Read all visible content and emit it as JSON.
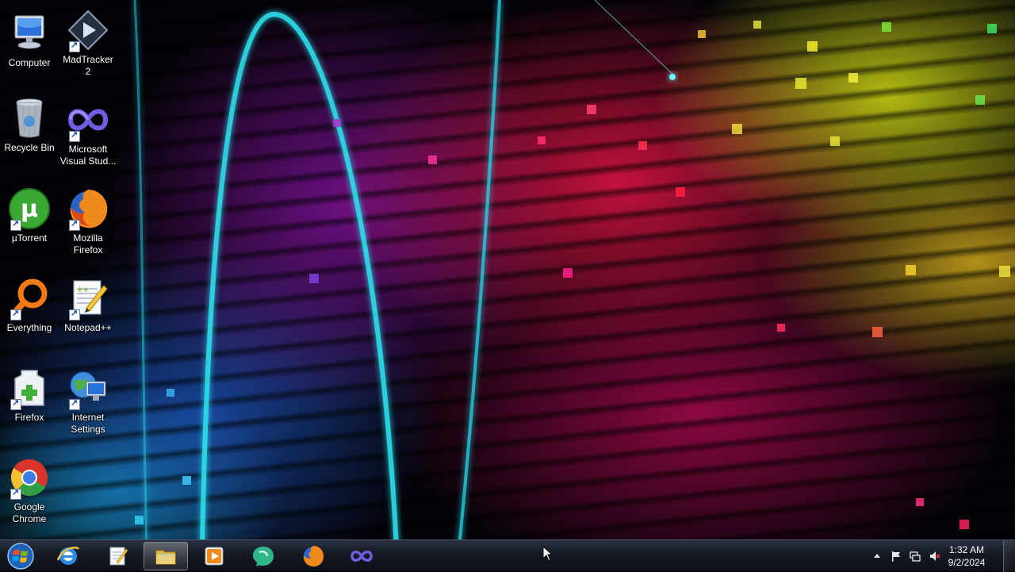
{
  "desktop": {
    "icons": [
      {
        "label": "Computer",
        "icon": "computer-icon"
      },
      {
        "label": "MadTracker 2",
        "icon": "madtracker-icon"
      },
      {
        "label": "Recycle Bin",
        "icon": "recycle-bin-icon"
      },
      {
        "label": "Microsoft Visual Stud...",
        "icon": "visual-studio-icon"
      },
      {
        "label": "µTorrent",
        "icon": "utorrent-icon"
      },
      {
        "label": "Mozilla Firefox",
        "icon": "firefox-icon"
      },
      {
        "label": "Everything",
        "icon": "everything-search-icon"
      },
      {
        "label": "Notepad++",
        "icon": "notepad-plus-plus-icon"
      },
      {
        "label": "Firefox",
        "icon": "firefox-portable-icon"
      },
      {
        "label": "Internet Settings",
        "icon": "internet-settings-icon"
      },
      {
        "label": "Google Chrome",
        "icon": "chrome-icon"
      }
    ]
  },
  "taskbar": {
    "start_icon": "windows-start-orb-icon",
    "pinned": [
      {
        "icon": "internet-explorer-icon",
        "active": false
      },
      {
        "icon": "notepad-icon",
        "active": false
      },
      {
        "icon": "file-explorer-icon",
        "active": true
      },
      {
        "icon": "media-player-icon",
        "active": false
      },
      {
        "icon": "chat-app-icon",
        "active": false
      },
      {
        "icon": "firefox-icon",
        "active": false
      },
      {
        "icon": "visual-studio-icon",
        "active": false
      }
    ],
    "tray": {
      "icons": [
        "show-hidden-icons-arrow",
        "action-center-flag-icon",
        "network-icon",
        "volume-muted-icon"
      ],
      "time": "1:32 AM",
      "date": "9/2/2024"
    }
  },
  "colors": {
    "taskbar_bg": "#151a24",
    "label_text": "#ffffff",
    "cyan_ring": "#2fe3f0"
  }
}
